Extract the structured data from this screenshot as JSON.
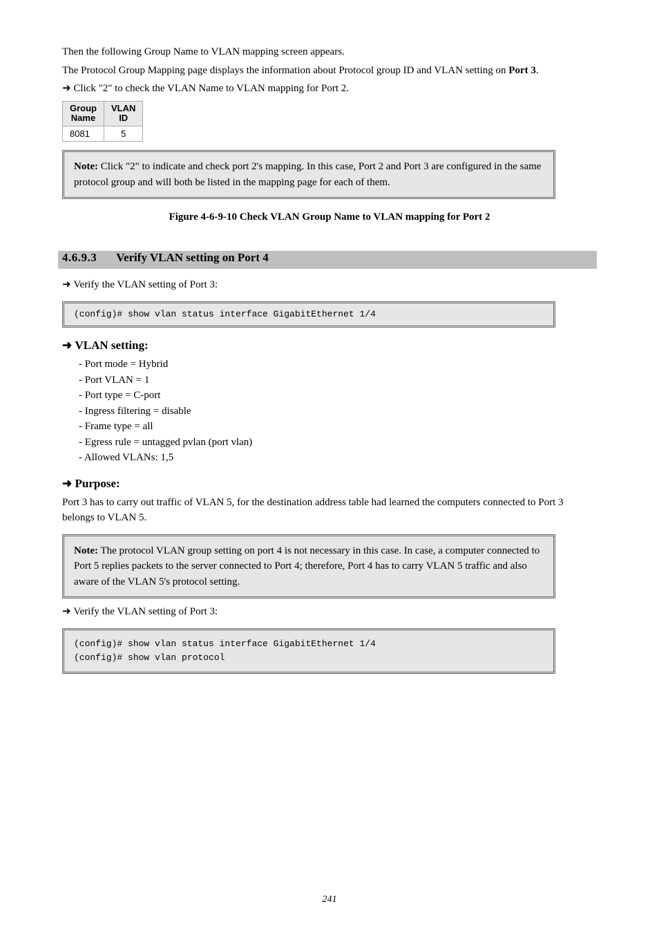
{
  "intro": {
    "line1": "Then the following Group Name to VLAN mapping screen appears.",
    "line2_prefix": "The Protocol Group Mapping page displays the information about Protocol group ID and VLAN setting on ",
    "line2_bold": "Port 3",
    "arrow": "Click \"2\" to check the VLAN Name to VLAN mapping for Port 2."
  },
  "table": {
    "h1a": "Group",
    "h1b": "Name",
    "h2a": "VLAN",
    "h2b": "ID",
    "r1c1": "8081",
    "r1c2": "5"
  },
  "figcap": "Figure 4-6-9-10 Check VLAN Group Name to VLAN mapping for Port 2",
  "note1": {
    "label": "Note:",
    "text": " Click \"2\" to indicate and check port 2's mapping. In this case, Port 2 and Port 3 are configured in the same protocol group and will both be listed in the mapping page for each of them."
  },
  "section": {
    "num": "4.6.9.3",
    "title": "Verify VLAN setting on Port 4"
  },
  "cli1": "(config)# show vlan status interface GigabitEthernet 1/4",
  "h_vlan_setting": "VLAN setting:",
  "h_purpose": "Purpose:",
  "vlan_items": [
    "Port mode = Hybrid",
    "Port VLAN = 1",
    "Port type = C-port",
    "Ingress filtering = disable",
    "Frame type = all",
    "Egress rule = untagged pvlan (port vlan)",
    "Allowed VLANs: 1,5"
  ],
  "purpose_line": "Port 3 has to carry out traffic of VLAN 5, for the destination address table had learned the computers connected to Port 3 belongs to VLAN 5.",
  "note2": {
    "label": "Note:",
    "text": " The protocol VLAN group setting on port 4 is not necessary in this case. In case, a computer connected to Port 5 replies packets to the server connected to Port 4; therefore, Port 4 has to carry VLAN 5 traffic and also aware of the VLAN 5's protocol setting."
  },
  "h_verify": "Verify the VLAN setting of Port 3:",
  "cli2a": "(config)# show vlan status interface GigabitEthernet 1/4",
  "cli2b": "(config)# show vlan protocol",
  "pagenum": "241"
}
